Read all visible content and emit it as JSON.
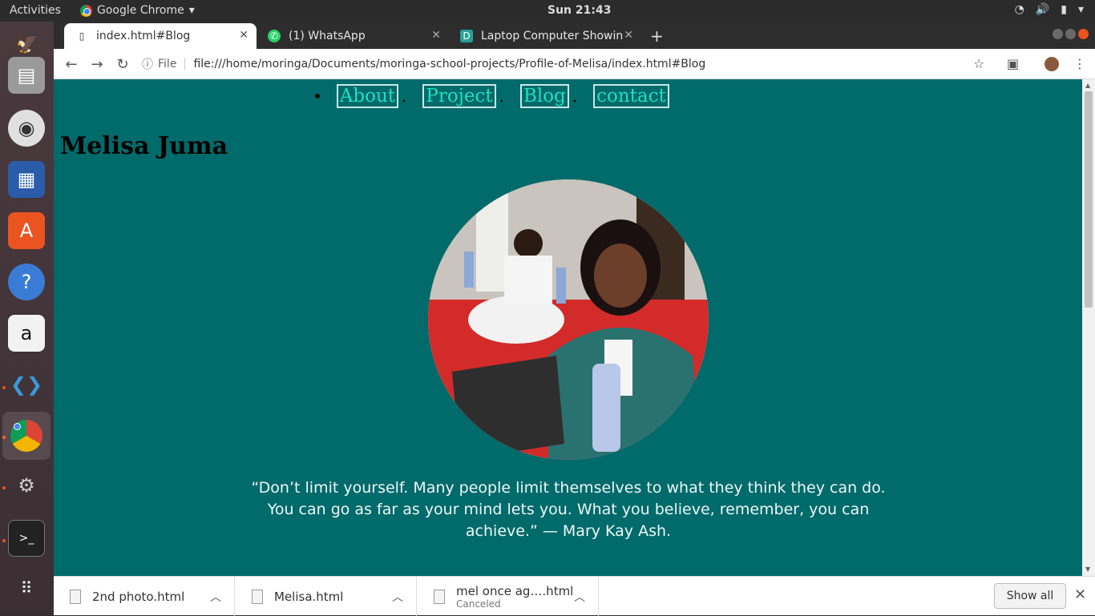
{
  "topbar": {
    "activities": "Activities",
    "app_name": "Google Chrome",
    "clock": "Sun 21:43"
  },
  "tabs": [
    {
      "label": "index.html#Blog",
      "icon": "page-icon"
    },
    {
      "label": "(1) WhatsApp",
      "icon": "whatsapp-icon"
    },
    {
      "label": "Laptop Computer Showin",
      "icon": "site-icon"
    }
  ],
  "toolbar": {
    "file_label": "File",
    "url": "file:///home/moringa/Documents/moringa-school-projects/Profile-of-Melisa/index.html#Blog"
  },
  "page": {
    "nav": [
      "About",
      "Project",
      "Blog",
      "contact"
    ],
    "name": "Melisa Juma",
    "quote": "“Don’t limit yourself. Many people limit themselves to what they think they can do. You can go as far as your mind lets you. What you believe, remember, you can achieve.” — Mary Kay Ash."
  },
  "downloads": {
    "items": [
      {
        "name": "2nd photo.html",
        "status": ""
      },
      {
        "name": "Melisa.html",
        "status": ""
      },
      {
        "name": "mel once ag….html",
        "status": "Canceled"
      }
    ],
    "show_all": "Show all"
  },
  "colors": {
    "page_bg": "#016a6a",
    "nav_link": "#1ee0c0",
    "ubuntu_accent": "#e95420"
  }
}
